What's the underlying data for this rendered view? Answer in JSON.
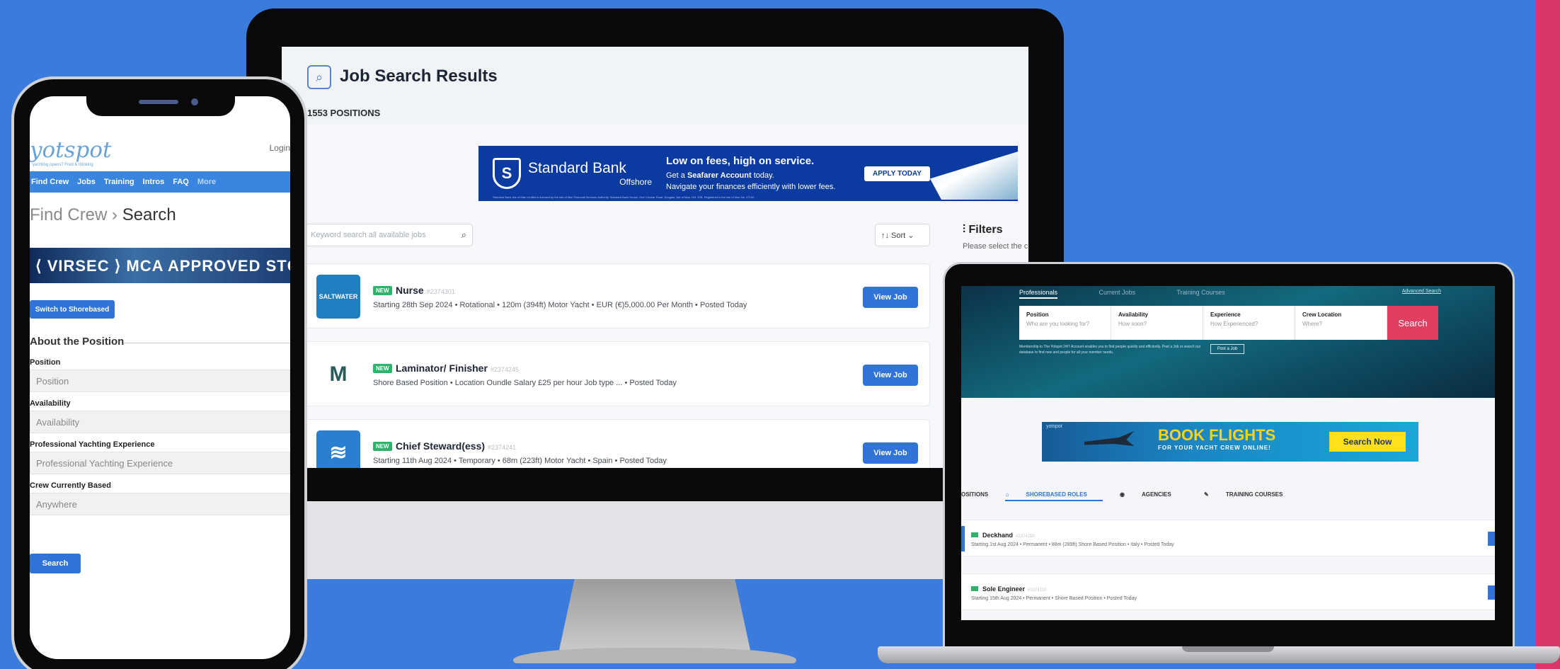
{
  "monitor": {
    "title": "Job Search Results",
    "positions_count": "1553 POSITIONS",
    "ad": {
      "brand_name": "Standard Bank",
      "brand_sub": "Offshore",
      "headline": "Low on fees, high on service.",
      "line1_pre": "Get a ",
      "line1_bold": "Seafarer Account",
      "line1_post": " today.",
      "line2": "Navigate your finances efficiently with lower fees.",
      "cta": "APPLY TODAY",
      "fineprint": "Standard Bank Isle of Man Limited is licensed by the Isle of Man Financial Services Authority. Standard Bank House, One Circular Road, Douglas, Isle of Man, IM1 1SB. Registered in the Isle of Man No. 4713C"
    },
    "keyword_placeholder": "Keyword search all available jobs",
    "sort_label": "↑↓ Sort",
    "filters_title": "Filters",
    "filters_desc": "Please select the c",
    "jobs": [
      {
        "logo_text": "SALTWATER",
        "badge": "NEW",
        "title": "Nurse",
        "id": "#2374301",
        "meta": "Starting 28th Sep 2024  •  Rotational  •  120m (394ft) Motor Yacht  •  EUR (€)5,000.00 Per Month  •  Posted Today",
        "button": "View Job",
        "logo_color": "#1f7fbf"
      },
      {
        "logo_text": "M",
        "badge": "NEW",
        "title": "Laminator/ Finisher",
        "id": "#2374245",
        "meta": "Shore Based Position  •  Location Oundle Salary £25 per hour Job type ...  •  Posted Today",
        "button": "View Job",
        "logo_color": "#ffffff"
      },
      {
        "logo_text": "≋",
        "badge": "NEW",
        "title": "Chief Steward(ess)",
        "id": "#2374241",
        "meta": "Starting 11th Aug 2024  •  Temporary  •  68m (223ft) Motor Yacht  •  Spain  •  Posted Today",
        "button": "View Job",
        "logo_color": "#2b7fd0"
      }
    ]
  },
  "phone": {
    "logo": "yotspot",
    "tagline": "yachting opens? Fred & thinking",
    "login": "Login",
    "nav": [
      "Find Crew",
      "Jobs",
      "Training",
      "Intros",
      "FAQ",
      "More"
    ],
    "crumb_parent": "Find Crew",
    "crumb_sep": "›",
    "crumb_current": "Search",
    "ad_text": "⟨ VIRSEC ⟩  MCA APPROVED STCW ISPS",
    "switch_button": "Switch to Shorebased",
    "about_heading": "About the Position",
    "fields": [
      {
        "label": "Position",
        "placeholder": "Position"
      },
      {
        "label": "Availability",
        "placeholder": "Availability"
      },
      {
        "label": "Professional Yachting Experience",
        "placeholder": "Professional Yachting Experience"
      },
      {
        "label": "Crew Currently Based",
        "placeholder": "Anywhere"
      }
    ],
    "search_button": "Search"
  },
  "laptop": {
    "tabs": [
      "Professionals",
      "Current Jobs",
      "Training Courses"
    ],
    "advanced": "Advanced Search",
    "form": [
      {
        "label": "Position",
        "placeholder": "Who are you looking for?"
      },
      {
        "label": "Availability",
        "placeholder": "How soon?"
      },
      {
        "label": "Experience",
        "placeholder": "How Experienced?"
      },
      {
        "label": "Crew Location",
        "placeholder": "Where?"
      }
    ],
    "search_button": "Search",
    "note": "Membership to The Yotspot 24/7 Account enables you to find people quickly and efficiently. Post a Job or search our database to find new and people for all your member needs.",
    "post_button": "Post a Job",
    "ad": {
      "small_brand": "yotspot",
      "title": "BOOK FLIGHTS",
      "subtitle": "FOR YOUR YACHT CREW ONLINE!",
      "button": "Search Now"
    },
    "list_tabs": [
      "OSITIONS",
      "SHOREBASED ROLES",
      "AGENCIES",
      "TRAINING COURSES"
    ],
    "jobs": [
      {
        "title": "Deckhand",
        "id": "#2374150",
        "meta": "Starting 1st Aug 2024  •  Permanent  •  88m (289ft) Shore Based Position  •  Italy  •  Posted Today"
      },
      {
        "title": "Sole Engineer",
        "id": "#2374110",
        "meta": "Starting 15th Aug 2024  •  Permanent  •  Shore Based Position  •  Posted Today"
      }
    ]
  },
  "colors": {
    "background": "#3a7bdc",
    "accent_pink": "#d9376a",
    "button_blue": "#2f74d6",
    "new_badge": "#2fb36b",
    "search_pink": "#e23e62"
  }
}
